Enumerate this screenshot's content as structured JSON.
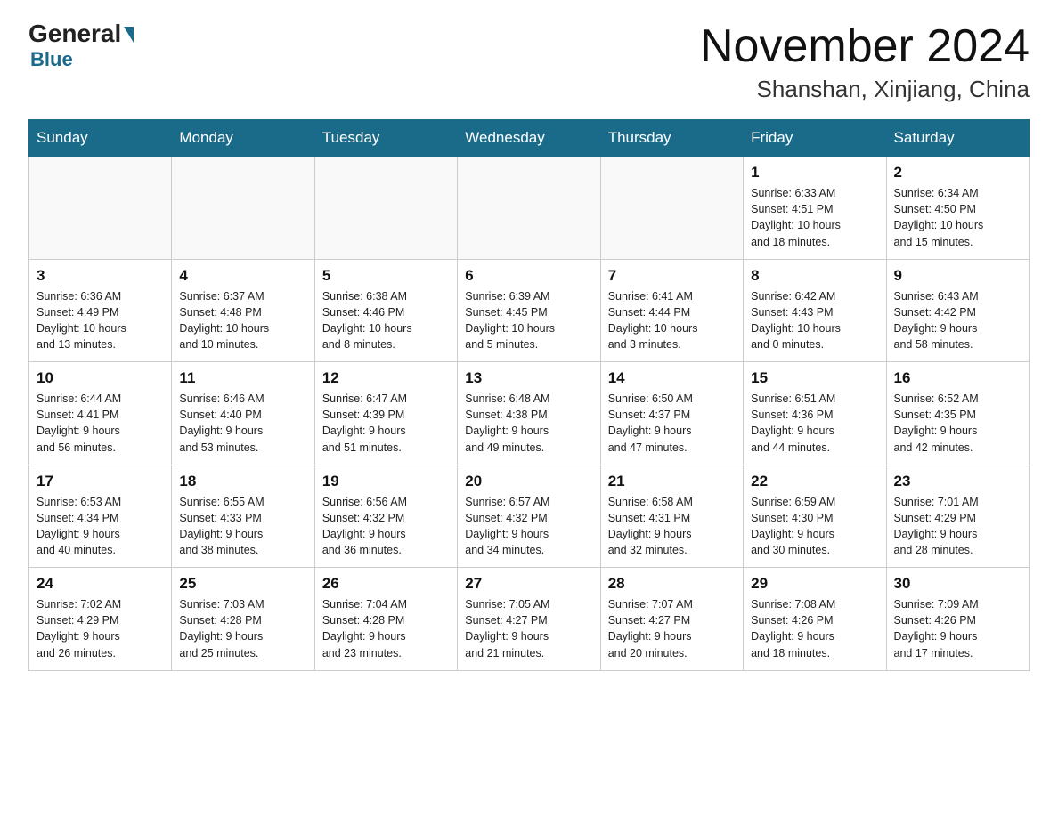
{
  "logo": {
    "general": "General",
    "blue": "Blue"
  },
  "header": {
    "month": "November 2024",
    "location": "Shanshan, Xinjiang, China"
  },
  "days_of_week": [
    "Sunday",
    "Monday",
    "Tuesday",
    "Wednesday",
    "Thursday",
    "Friday",
    "Saturday"
  ],
  "weeks": [
    [
      {
        "day": "",
        "info": ""
      },
      {
        "day": "",
        "info": ""
      },
      {
        "day": "",
        "info": ""
      },
      {
        "day": "",
        "info": ""
      },
      {
        "day": "",
        "info": ""
      },
      {
        "day": "1",
        "info": "Sunrise: 6:33 AM\nSunset: 4:51 PM\nDaylight: 10 hours\nand 18 minutes."
      },
      {
        "day": "2",
        "info": "Sunrise: 6:34 AM\nSunset: 4:50 PM\nDaylight: 10 hours\nand 15 minutes."
      }
    ],
    [
      {
        "day": "3",
        "info": "Sunrise: 6:36 AM\nSunset: 4:49 PM\nDaylight: 10 hours\nand 13 minutes."
      },
      {
        "day": "4",
        "info": "Sunrise: 6:37 AM\nSunset: 4:48 PM\nDaylight: 10 hours\nand 10 minutes."
      },
      {
        "day": "5",
        "info": "Sunrise: 6:38 AM\nSunset: 4:46 PM\nDaylight: 10 hours\nand 8 minutes."
      },
      {
        "day": "6",
        "info": "Sunrise: 6:39 AM\nSunset: 4:45 PM\nDaylight: 10 hours\nand 5 minutes."
      },
      {
        "day": "7",
        "info": "Sunrise: 6:41 AM\nSunset: 4:44 PM\nDaylight: 10 hours\nand 3 minutes."
      },
      {
        "day": "8",
        "info": "Sunrise: 6:42 AM\nSunset: 4:43 PM\nDaylight: 10 hours\nand 0 minutes."
      },
      {
        "day": "9",
        "info": "Sunrise: 6:43 AM\nSunset: 4:42 PM\nDaylight: 9 hours\nand 58 minutes."
      }
    ],
    [
      {
        "day": "10",
        "info": "Sunrise: 6:44 AM\nSunset: 4:41 PM\nDaylight: 9 hours\nand 56 minutes."
      },
      {
        "day": "11",
        "info": "Sunrise: 6:46 AM\nSunset: 4:40 PM\nDaylight: 9 hours\nand 53 minutes."
      },
      {
        "day": "12",
        "info": "Sunrise: 6:47 AM\nSunset: 4:39 PM\nDaylight: 9 hours\nand 51 minutes."
      },
      {
        "day": "13",
        "info": "Sunrise: 6:48 AM\nSunset: 4:38 PM\nDaylight: 9 hours\nand 49 minutes."
      },
      {
        "day": "14",
        "info": "Sunrise: 6:50 AM\nSunset: 4:37 PM\nDaylight: 9 hours\nand 47 minutes."
      },
      {
        "day": "15",
        "info": "Sunrise: 6:51 AM\nSunset: 4:36 PM\nDaylight: 9 hours\nand 44 minutes."
      },
      {
        "day": "16",
        "info": "Sunrise: 6:52 AM\nSunset: 4:35 PM\nDaylight: 9 hours\nand 42 minutes."
      }
    ],
    [
      {
        "day": "17",
        "info": "Sunrise: 6:53 AM\nSunset: 4:34 PM\nDaylight: 9 hours\nand 40 minutes."
      },
      {
        "day": "18",
        "info": "Sunrise: 6:55 AM\nSunset: 4:33 PM\nDaylight: 9 hours\nand 38 minutes."
      },
      {
        "day": "19",
        "info": "Sunrise: 6:56 AM\nSunset: 4:32 PM\nDaylight: 9 hours\nand 36 minutes."
      },
      {
        "day": "20",
        "info": "Sunrise: 6:57 AM\nSunset: 4:32 PM\nDaylight: 9 hours\nand 34 minutes."
      },
      {
        "day": "21",
        "info": "Sunrise: 6:58 AM\nSunset: 4:31 PM\nDaylight: 9 hours\nand 32 minutes."
      },
      {
        "day": "22",
        "info": "Sunrise: 6:59 AM\nSunset: 4:30 PM\nDaylight: 9 hours\nand 30 minutes."
      },
      {
        "day": "23",
        "info": "Sunrise: 7:01 AM\nSunset: 4:29 PM\nDaylight: 9 hours\nand 28 minutes."
      }
    ],
    [
      {
        "day": "24",
        "info": "Sunrise: 7:02 AM\nSunset: 4:29 PM\nDaylight: 9 hours\nand 26 minutes."
      },
      {
        "day": "25",
        "info": "Sunrise: 7:03 AM\nSunset: 4:28 PM\nDaylight: 9 hours\nand 25 minutes."
      },
      {
        "day": "26",
        "info": "Sunrise: 7:04 AM\nSunset: 4:28 PM\nDaylight: 9 hours\nand 23 minutes."
      },
      {
        "day": "27",
        "info": "Sunrise: 7:05 AM\nSunset: 4:27 PM\nDaylight: 9 hours\nand 21 minutes."
      },
      {
        "day": "28",
        "info": "Sunrise: 7:07 AM\nSunset: 4:27 PM\nDaylight: 9 hours\nand 20 minutes."
      },
      {
        "day": "29",
        "info": "Sunrise: 7:08 AM\nSunset: 4:26 PM\nDaylight: 9 hours\nand 18 minutes."
      },
      {
        "day": "30",
        "info": "Sunrise: 7:09 AM\nSunset: 4:26 PM\nDaylight: 9 hours\nand 17 minutes."
      }
    ]
  ]
}
